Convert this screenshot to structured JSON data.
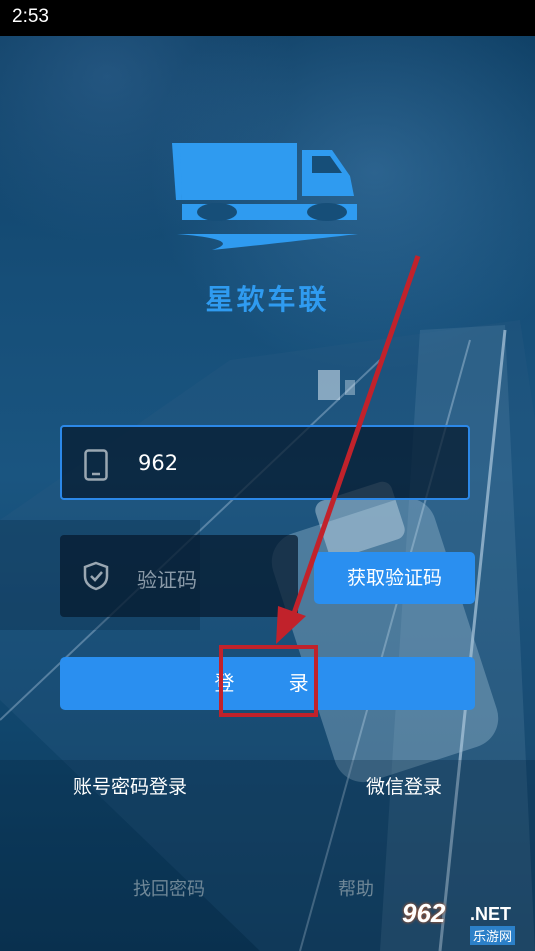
{
  "status_bar": {
    "time": "2:53"
  },
  "app": {
    "name": "星软车联",
    "brand_color": "#2f9bf0"
  },
  "phone_input": {
    "value": "962",
    "icon": "phone-icon"
  },
  "code_input": {
    "placeholder": "验证码",
    "icon": "shield-check-icon"
  },
  "buttons": {
    "get_code": "获取验证码",
    "login": "登 录"
  },
  "links": {
    "account_password_login": "账号密码登录",
    "wechat_login": "微信登录",
    "find_password": "找回密码",
    "help": "帮助"
  },
  "annotation": {
    "color": "#c1222b"
  },
  "watermark": {
    "number": "962",
    "suffix": ".NET",
    "name": "乐游网"
  }
}
